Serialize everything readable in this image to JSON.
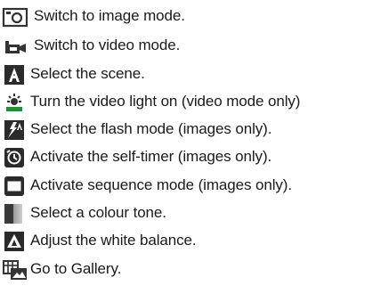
{
  "items": [
    {
      "icon": "camera-icon",
      "label": "Switch to image mode."
    },
    {
      "icon": "video-camera-icon",
      "label": "Switch to video mode."
    },
    {
      "icon": "scene-icon",
      "label": "Select the scene."
    },
    {
      "icon": "video-light-icon",
      "label": "Turn the video light on (video mode only)"
    },
    {
      "icon": "flash-icon",
      "label": "Select the flash mode (images only)."
    },
    {
      "icon": "self-timer-icon",
      "label": "Activate the self-timer (images only)."
    },
    {
      "icon": "sequence-mode-icon",
      "label": "Activate sequence mode (images only)."
    },
    {
      "icon": "colour-tone-icon",
      "label": "Select a colour tone."
    },
    {
      "icon": "white-balance-icon",
      "label": "Adjust the white balance."
    },
    {
      "icon": "gallery-icon",
      "label": "Go to Gallery."
    }
  ]
}
